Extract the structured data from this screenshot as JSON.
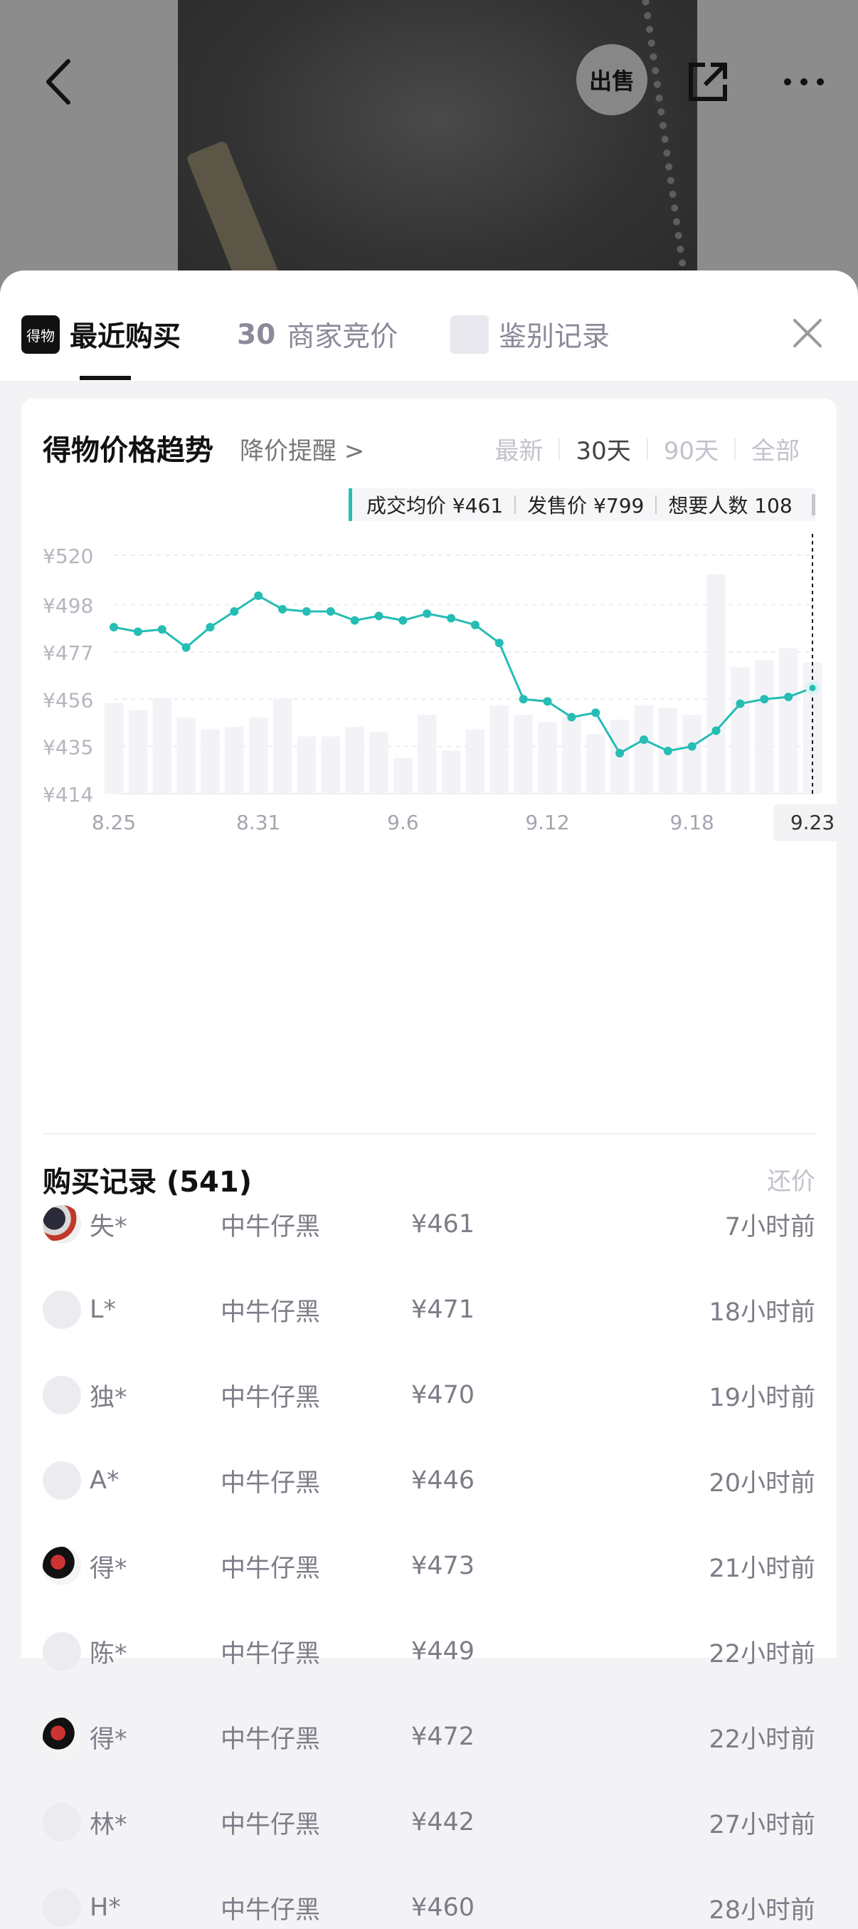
{
  "header": {
    "sell_label": "出售"
  },
  "tabs": {
    "badge": "得物",
    "recent": "最近购买",
    "merchant_count": "30",
    "merchants": "商家竞价",
    "auth": "鉴别记录"
  },
  "trend": {
    "title": "得物价格趋势",
    "alert": "降价提醒 >",
    "ranges": [
      "最新",
      "30天",
      "90天",
      "全部"
    ],
    "active_range": "30天",
    "stats": {
      "avg": "成交均价 ¥461",
      "release": "发售价 ¥799",
      "wants": "想要人数 108"
    }
  },
  "chart_data": {
    "type": "line",
    "ylim": [
      414,
      520
    ],
    "y_ticks": [
      "¥520",
      "¥498",
      "¥477",
      "¥456",
      "¥435",
      "¥414"
    ],
    "y_tick_values": [
      520,
      498,
      477,
      456,
      435,
      414
    ],
    "x_tick_labels": [
      "8.25",
      "8.31",
      "9.6",
      "9.12",
      "9.18",
      "9.23"
    ],
    "x_tick_index": [
      0,
      6,
      12,
      18,
      24,
      29
    ],
    "highlight_label": "9.23",
    "series": [
      {
        "values": [
          488,
          486,
          487,
          479,
          488,
          495,
          502,
          496,
          495,
          495,
          491,
          493,
          491,
          494,
          492,
          489,
          481,
          456,
          455,
          448,
          450,
          432,
          438,
          433,
          435,
          442,
          454,
          456,
          457,
          461
        ],
        "color": "#25bdb4"
      }
    ],
    "volume_bars": [
      38,
      35,
      40,
      32,
      27,
      28,
      32,
      40,
      24,
      24,
      28,
      26,
      15,
      33,
      18,
      27,
      37,
      33,
      30,
      33,
      25,
      31,
      37,
      36,
      33,
      92,
      53,
      56,
      61,
      55
    ]
  },
  "records": {
    "title": "购买记录 (541)",
    "bid": "还价",
    "rows": [
      {
        "user": "失*",
        "spec": "中牛仔黑",
        "price": "¥461",
        "time": "7小时前",
        "avatar": "img1"
      },
      {
        "user": "L*",
        "spec": "中牛仔黑",
        "price": "¥471",
        "time": "18小时前",
        "avatar": "plain"
      },
      {
        "user": "独*",
        "spec": "中牛仔黑",
        "price": "¥470",
        "time": "19小时前",
        "avatar": "plain"
      },
      {
        "user": "A*",
        "spec": "中牛仔黑",
        "price": "¥446",
        "time": "20小时前",
        "avatar": "plain"
      },
      {
        "user": "得*",
        "spec": "中牛仔黑",
        "price": "¥473",
        "time": "21小时前",
        "avatar": "img2"
      },
      {
        "user": "陈*",
        "spec": "中牛仔黑",
        "price": "¥449",
        "time": "22小时前",
        "avatar": "plain"
      },
      {
        "user": "得*",
        "spec": "中牛仔黑",
        "price": "¥472",
        "time": "22小时前",
        "avatar": "img2"
      },
      {
        "user": "林*",
        "spec": "中牛仔黑",
        "price": "¥442",
        "time": "27小时前",
        "avatar": "plain"
      },
      {
        "user": "H*",
        "spec": "中牛仔黑",
        "price": "¥460",
        "time": "28小时前",
        "avatar": "plain"
      }
    ]
  }
}
